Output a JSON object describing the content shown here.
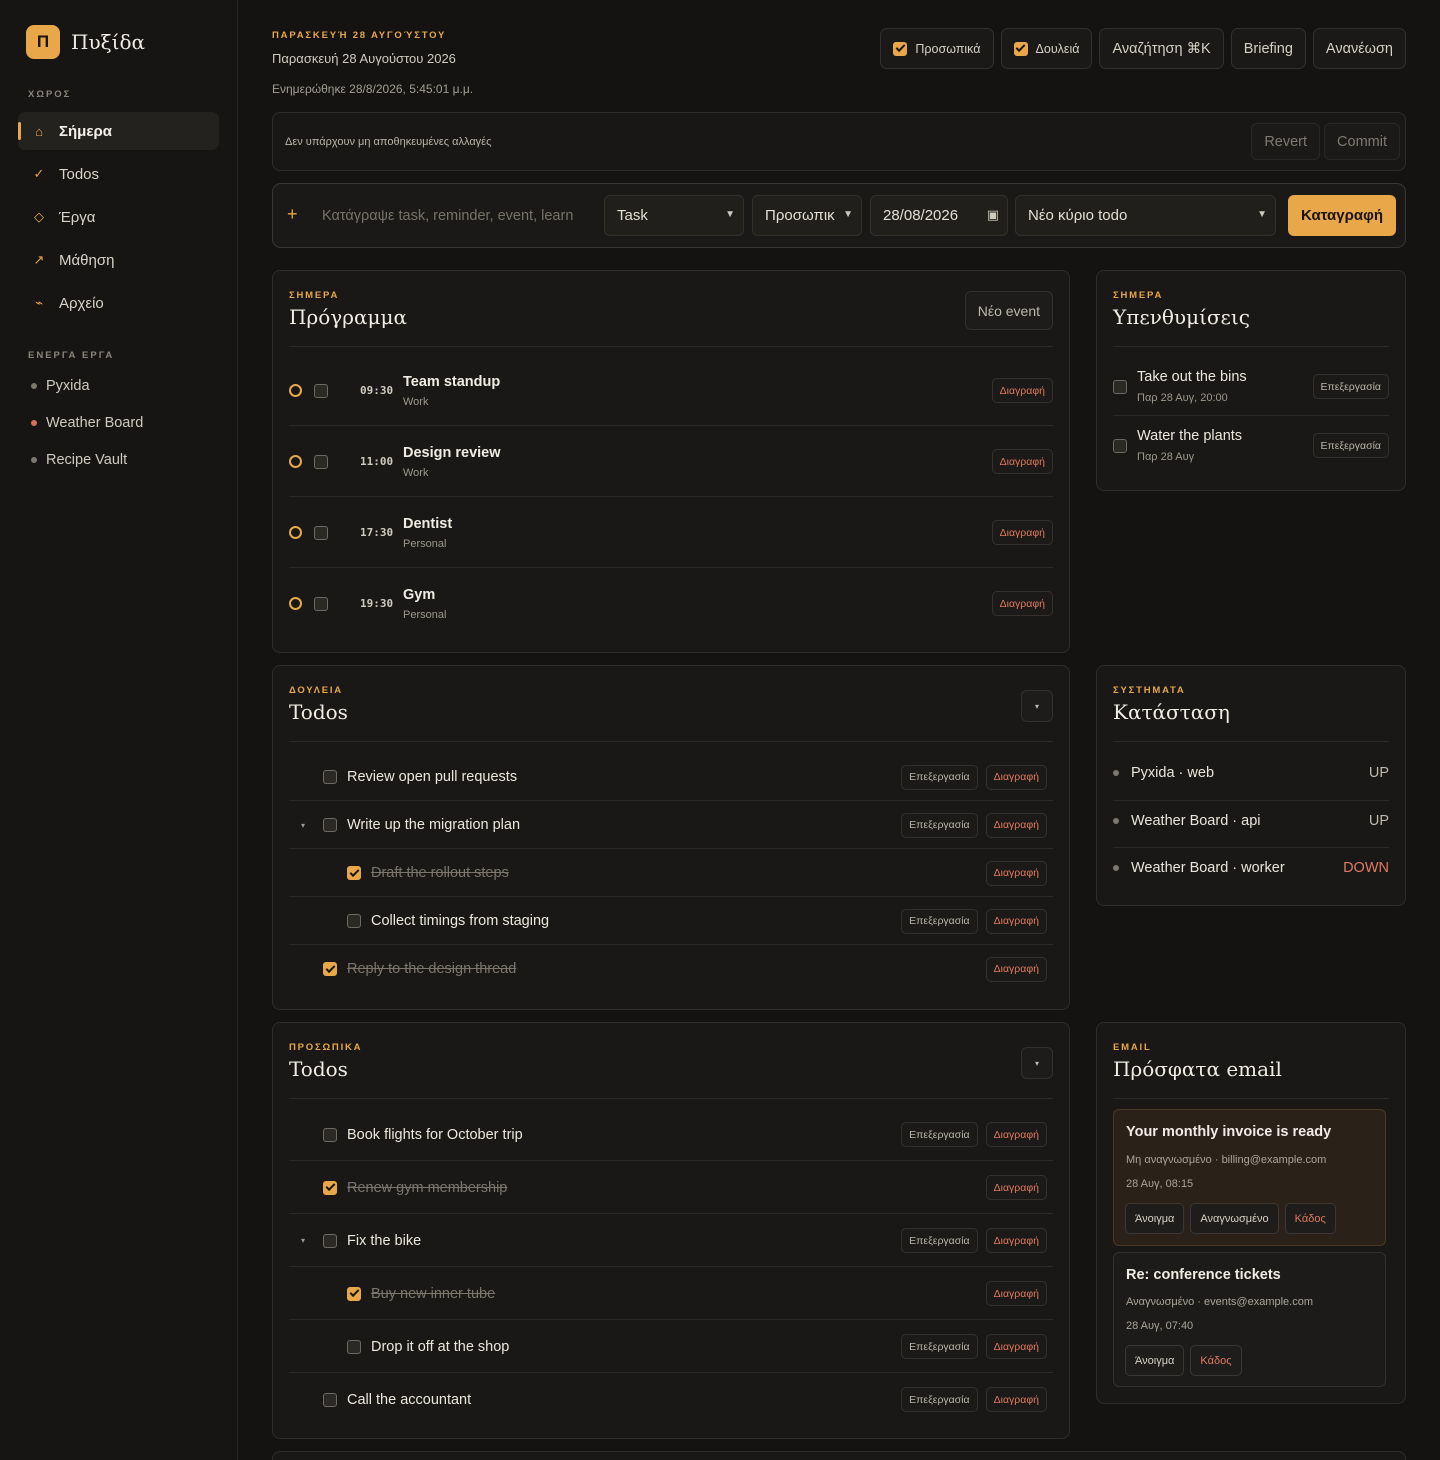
{
  "app": {
    "logo_letter": "Π",
    "name": "Πυξίδα",
    "accent": "#e8a84a"
  },
  "sidebar": {
    "section_space": "ΧΩΡΟΣ",
    "nav": [
      {
        "label": "Σήμερα",
        "icon": "home-icon"
      },
      {
        "label": "Todos",
        "icon": "check-icon"
      },
      {
        "label": "Έργα",
        "icon": "diamond-icon"
      },
      {
        "label": "Μάθηση",
        "icon": "arrow-up-right-icon"
      },
      {
        "label": "Αρχείο",
        "icon": "archive-icon"
      }
    ],
    "section_projects": "ΕΝΕΡΓΑ ΕΡΓΑ",
    "projects": [
      {
        "label": "Pyxida",
        "status": "ok"
      },
      {
        "label": "Weather Board",
        "status": "alert"
      },
      {
        "label": "Recipe Vault",
        "status": "ok"
      }
    ]
  },
  "header": {
    "eyebrow": "ΠΑΡΑΣΚΕΥΉ 28 ΑΥΓΟΎΣΤΟΥ",
    "date": "Παρασκευή 28 Αυγούστου 2026",
    "updated": "Ενημερώθηκε 28/8/2026, 5:45:01 μ.μ.",
    "filter_personal": "Προσωπικά",
    "filter_work": "Δουλειά",
    "search": "Αναζήτηση ⌘K",
    "briefing": "Briefing",
    "refresh": "Ανανέωση"
  },
  "unsaved": {
    "text": "Δεν υπάρχουν μη αποθηκευμένες αλλαγές",
    "revert": "Revert",
    "commit": "Commit"
  },
  "capture": {
    "placeholder": "Κατάγραψε task, reminder, event, learn",
    "type": "Task",
    "scope": "Προσωπικ",
    "date": "28/08/2026",
    "parent": "Νέο κύριο todo",
    "submit": "Καταγραφή"
  },
  "schedule": {
    "eyebrow": "ΣΗΜΕΡΑ",
    "title": "Πρόγραμμα",
    "new_event": "Νέο event",
    "delete_label": "Διαγραφή",
    "events": [
      {
        "time": "09:30",
        "title": "Team standup",
        "tag": "Work"
      },
      {
        "time": "11:00",
        "title": "Design review",
        "tag": "Work"
      },
      {
        "time": "17:30",
        "title": "Dentist",
        "tag": "Personal"
      },
      {
        "time": "19:30",
        "title": "Gym",
        "tag": "Personal"
      }
    ]
  },
  "reminders": {
    "eyebrow": "ΣΗΜΕΡΑ",
    "title": "Υπενθυμίσεις",
    "edit_label": "Επεξεργασία",
    "items": [
      {
        "title": "Take out the bins",
        "when": "Παρ 28 Αυγ, 20:00"
      },
      {
        "title": "Water the plants",
        "when": "Παρ 28 Αυγ"
      }
    ]
  },
  "work_todos": {
    "eyebrow": "ΔΟΥΛΕΙΑ",
    "title": "Todos",
    "collapse": "▾",
    "edit_label": "Επεξεργασία",
    "delete_label": "Διαγραφή",
    "items": [
      {
        "text": "Review open pull requests",
        "done": false
      },
      {
        "text": "Write up the migration plan",
        "done": false,
        "expanded": true
      },
      {
        "text": "Draft the rollout steps",
        "done": true,
        "child": true
      },
      {
        "text": "Collect timings from staging",
        "done": false,
        "child": true
      },
      {
        "text": "Reply to the design thread",
        "done": true
      }
    ]
  },
  "status": {
    "eyebrow": "ΣΥΣΤΗΜΑΤΑ",
    "title": "Κατάσταση",
    "services": [
      {
        "name": "Pyxida · web",
        "state": "UP",
        "color": "#bdb8ae"
      },
      {
        "name": "Weather Board · api",
        "state": "UP",
        "color": "#bdb8ae"
      },
      {
        "name": "Weather Board · worker",
        "state": "DOWN",
        "color": "#e07a5f"
      }
    ]
  },
  "personal_todos": {
    "eyebrow": "ΠΡΟΣΩΠΙΚΑ",
    "title": "Todos",
    "collapse": "▾",
    "edit_label": "Επεξεργασία",
    "delete_label": "Διαγραφή",
    "items": [
      {
        "text": "Book flights for October trip",
        "done": false
      },
      {
        "text": "Renew gym membership",
        "done": true
      },
      {
        "text": "Fix the bike",
        "done": false,
        "expanded": true
      },
      {
        "text": "Buy new inner tube",
        "done": true,
        "child": true
      },
      {
        "text": "Drop it off at the shop",
        "done": false,
        "child": true
      },
      {
        "text": "Call the accountant",
        "done": false
      }
    ]
  },
  "email": {
    "eyebrow": "EMAIL",
    "title": "Πρόσφατα email",
    "messages": [
      {
        "subject": "Your monthly invoice is ready",
        "meta": "Μη αναγνωσμένο · billing@example.com",
        "date": "28 Αυγ, 08:15",
        "open": "Άνοιγμα",
        "mark": "Αναγνωσμένο",
        "trash": "Κάδος",
        "unread": true
      },
      {
        "subject": "Re: conference tickets",
        "meta": "Αναγνωσμένο · events@example.com",
        "date": "28 Αυγ, 07:40",
        "open": "Άνοιγμα",
        "trash": "Κάδος",
        "unread": false
      }
    ]
  }
}
